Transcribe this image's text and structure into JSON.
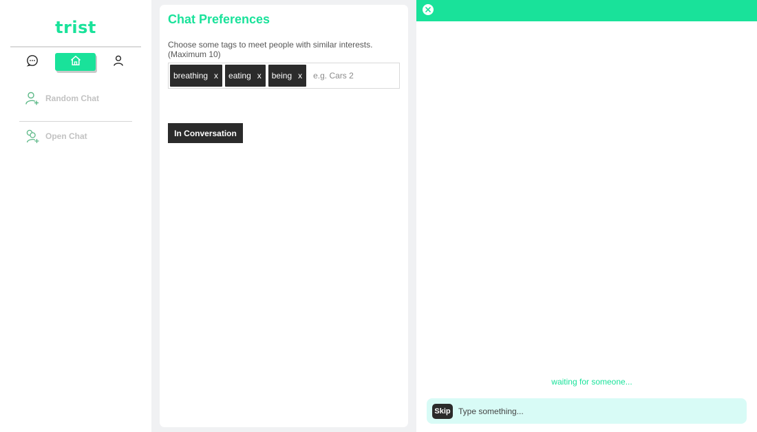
{
  "app": {
    "logo": "trist"
  },
  "sidebar": {
    "nav": [
      {
        "icon": "chat-bubble-icon"
      },
      {
        "icon": "home-icon",
        "active": true
      },
      {
        "icon": "user-icon"
      }
    ],
    "items": [
      {
        "label": "Random Chat",
        "icon": "add-user-icon"
      },
      {
        "label": "Open Chat",
        "icon": "group-add-icon"
      }
    ]
  },
  "preferences": {
    "title": "Chat Preferences",
    "description": "Choose some tags to meet people with similar interests. (Maximum 10)",
    "tags": [
      {
        "label": "breathing",
        "remove": "x"
      },
      {
        "label": "eating",
        "remove": "x"
      },
      {
        "label": "being",
        "remove": "x"
      }
    ],
    "tag_input_placeholder": "e.g. Cars 2",
    "status_button": "In Conversation"
  },
  "chat": {
    "status": "waiting for someone...",
    "skip_label": "Skip",
    "input_placeholder": "Type something...",
    "close_icon": "close-icon"
  },
  "colors": {
    "accent": "#19e29a",
    "dark": "#2b2b2b",
    "input_bg": "#d8fbf6",
    "muted_label": "#c2c2c2"
  }
}
